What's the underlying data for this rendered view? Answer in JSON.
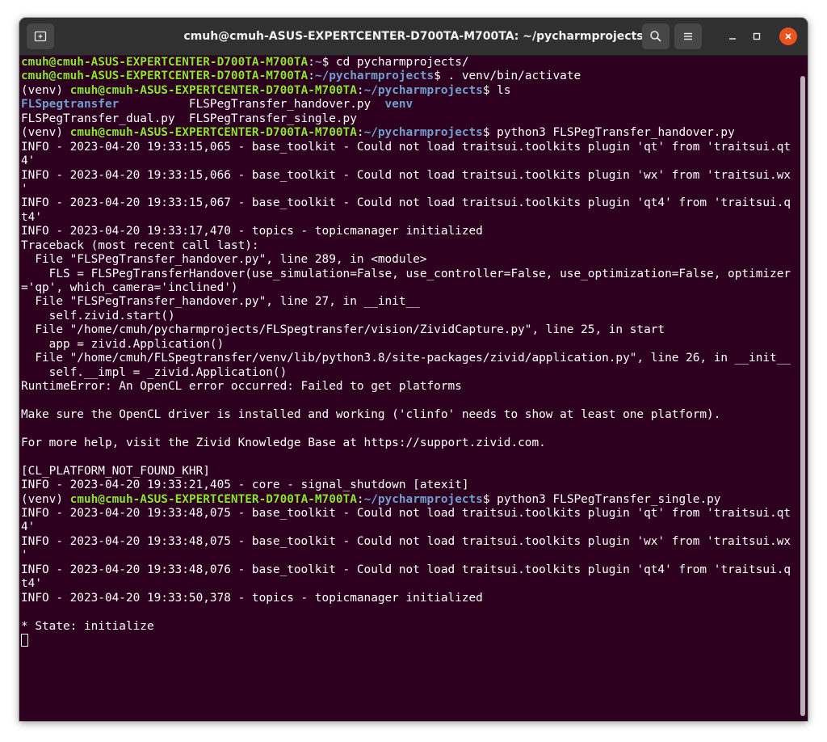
{
  "window": {
    "title": "cmuh@cmuh-ASUS-EXPERTCENTER-D700TA-M700TA: ~/pycharmprojects",
    "colors": {
      "background": "#2c001e",
      "titlebar": "#303030",
      "prompt_user": "#8ae234",
      "prompt_path": "#729fcf",
      "close": "#e95420"
    },
    "icons": [
      "new-tab-icon",
      "search-icon",
      "hamburger-menu-icon",
      "minimize-icon",
      "maximize-icon",
      "close-icon"
    ]
  },
  "terminal": {
    "lines": [
      [
        {
          "t": "cmuh@cmuh-ASUS-EXPERTCENTER-D700TA-M700TA",
          "c": "g"
        },
        {
          "t": ":"
        },
        {
          "t": "~",
          "c": "b"
        },
        {
          "t": "$ cd pycharmprojects/"
        }
      ],
      [
        {
          "t": "cmuh@cmuh-ASUS-EXPERTCENTER-D700TA-M700TA",
          "c": "g"
        },
        {
          "t": ":"
        },
        {
          "t": "~/pycharmprojects",
          "c": "b"
        },
        {
          "t": "$ . venv/bin/activate"
        }
      ],
      [
        {
          "t": "(venv) "
        },
        {
          "t": "cmuh@cmuh-ASUS-EXPERTCENTER-D700TA-M700TA",
          "c": "g"
        },
        {
          "t": ":"
        },
        {
          "t": "~/pycharmprojects",
          "c": "b"
        },
        {
          "t": "$ ls"
        }
      ],
      [
        {
          "t": "FLSpegtransfer",
          "c": "b"
        },
        {
          "t": "          FLSPegTransfer_handover.py  "
        },
        {
          "t": "venv",
          "c": "b"
        }
      ],
      [
        {
          "t": "FLSPegTransfer_dual.py  FLSPegTransfer_single.py"
        }
      ],
      [
        {
          "t": "(venv) "
        },
        {
          "t": "cmuh@cmuh-ASUS-EXPERTCENTER-D700TA-M700TA",
          "c": "g"
        },
        {
          "t": ":"
        },
        {
          "t": "~/pycharmprojects",
          "c": "b"
        },
        {
          "t": "$ python3 FLSPegTransfer_handover.py"
        }
      ],
      [
        {
          "t": "INFO - 2023-04-20 19:33:15,065 - base_toolkit - Could not load traitsui.toolkits plugin 'qt' from 'traitsui.qt"
        }
      ],
      [
        {
          "t": "4'"
        }
      ],
      [
        {
          "t": "INFO - 2023-04-20 19:33:15,066 - base_toolkit - Could not load traitsui.toolkits plugin 'wx' from 'traitsui.wx"
        }
      ],
      [
        {
          "t": "'"
        }
      ],
      [
        {
          "t": "INFO - 2023-04-20 19:33:15,067 - base_toolkit - Could not load traitsui.toolkits plugin 'qt4' from 'traitsui.q"
        }
      ],
      [
        {
          "t": "t4'"
        }
      ],
      [
        {
          "t": "INFO - 2023-04-20 19:33:17,470 - topics - topicmanager initialized"
        }
      ],
      [
        {
          "t": "Traceback (most recent call last):"
        }
      ],
      [
        {
          "t": "  File \"FLSPegTransfer_handover.py\", line 289, in <module>"
        }
      ],
      [
        {
          "t": "    FLS = FLSPegTransferHandover(use_simulation=False, use_controller=False, use_optimization=False, optimizer"
        }
      ],
      [
        {
          "t": "='qp', which_camera='inclined')"
        }
      ],
      [
        {
          "t": "  File \"FLSPegTransfer_handover.py\", line 27, in __init__"
        }
      ],
      [
        {
          "t": "    self.zivid.start()"
        }
      ],
      [
        {
          "t": "  File \"/home/cmuh/pycharmprojects/FLSpegtransfer/vision/ZividCapture.py\", line 25, in start"
        }
      ],
      [
        {
          "t": "    app = zivid.Application()"
        }
      ],
      [
        {
          "t": "  File \"/home/cmuh/FLSpegtransfer/venv/lib/python3.8/site-packages/zivid/application.py\", line 26, in __init__"
        }
      ],
      [
        {
          "t": "    self.__impl = _zivid.Application()"
        }
      ],
      [
        {
          "t": "RuntimeError: An OpenCL error occurred: Failed to get platforms"
        }
      ],
      [
        {
          "t": ""
        }
      ],
      [
        {
          "t": "Make sure the OpenCL driver is installed and working ('clinfo' needs to show at least one platform)."
        }
      ],
      [
        {
          "t": ""
        }
      ],
      [
        {
          "t": "For more help, visit the Zivid Knowledge Base at https://support.zivid.com."
        }
      ],
      [
        {
          "t": ""
        }
      ],
      [
        {
          "t": "[CL_PLATFORM_NOT_FOUND_KHR]"
        }
      ],
      [
        {
          "t": "INFO - 2023-04-20 19:33:21,405 - core - signal_shutdown [atexit]"
        }
      ],
      [
        {
          "t": "(venv) "
        },
        {
          "t": "cmuh@cmuh-ASUS-EXPERTCENTER-D700TA-M700TA",
          "c": "g"
        },
        {
          "t": ":"
        },
        {
          "t": "~/pycharmprojects",
          "c": "b"
        },
        {
          "t": "$ python3 FLSPegTransfer_single.py"
        }
      ],
      [
        {
          "t": "INFO - 2023-04-20 19:33:48,075 - base_toolkit - Could not load traitsui.toolkits plugin 'qt' from 'traitsui.qt"
        }
      ],
      [
        {
          "t": "4'"
        }
      ],
      [
        {
          "t": "INFO - 2023-04-20 19:33:48,075 - base_toolkit - Could not load traitsui.toolkits plugin 'wx' from 'traitsui.wx"
        }
      ],
      [
        {
          "t": "'"
        }
      ],
      [
        {
          "t": "INFO - 2023-04-20 19:33:48,076 - base_toolkit - Could not load traitsui.toolkits plugin 'qt4' from 'traitsui.q"
        }
      ],
      [
        {
          "t": "t4'"
        }
      ],
      [
        {
          "t": "INFO - 2023-04-20 19:33:50,378 - topics - topicmanager initialized"
        }
      ],
      [
        {
          "t": ""
        }
      ],
      [
        {
          "t": "* State: initialize"
        }
      ]
    ]
  }
}
